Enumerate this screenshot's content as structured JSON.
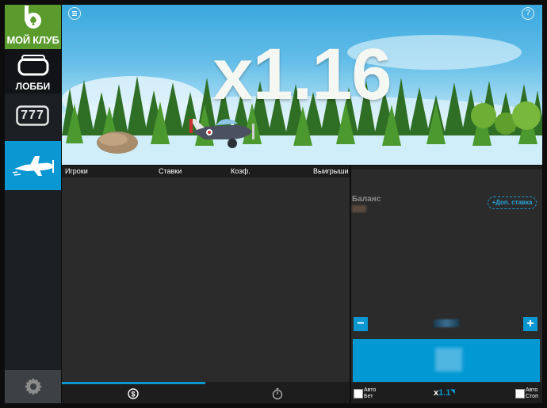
{
  "sidebar": {
    "club_label": "МОЙ КЛУБ",
    "lobby_label": "ЛОББИ",
    "slots_label": "777",
    "active_game": "aviator"
  },
  "game": {
    "multiplier": "x1.16",
    "info_icon": "info-icon",
    "help_label": "?"
  },
  "bets_table": {
    "columns": [
      "Игроки",
      "Ставки",
      "Коэф.",
      "Выигрыши"
    ],
    "rows": [],
    "tabs": [
      "bets-tab",
      "history-tab"
    ]
  },
  "bet_panel": {
    "balance_label": "Баланс",
    "extra_bet_label": "Доп. ставка",
    "minus_label": "−",
    "plus_label": "+",
    "auto_bet_label_1": "Авто",
    "auto_bet_label_2": "Бет",
    "auto_stop_label_1": "Авто",
    "auto_stop_label_2": "Стоп",
    "multiplier_x": "x",
    "multiplier_value": "1.1"
  },
  "colors": {
    "accent": "#0b97d1",
    "club_green": "#5b9a2c"
  }
}
